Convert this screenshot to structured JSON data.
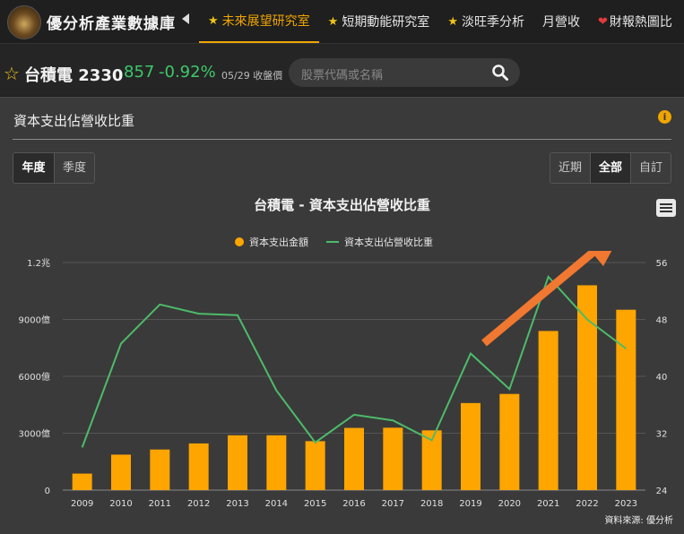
{
  "brand": "優分析產業數據庫",
  "nav": [
    {
      "label": "未來展望研究室",
      "icon": "star",
      "active": true
    },
    {
      "label": "短期動能研究室",
      "icon": "star",
      "active": false
    },
    {
      "label": "淡旺季分析",
      "icon": "star",
      "active": false
    },
    {
      "label": "月營收",
      "icon": "",
      "active": false
    },
    {
      "label": "財報熱圖比",
      "icon": "heart",
      "active": false
    }
  ],
  "stock": {
    "name": "台積電 2330",
    "price": "857",
    "change": "-0.92%",
    "date_label": "05/29 收盤價"
  },
  "search": {
    "placeholder": "股票代碼或名稱"
  },
  "panel": {
    "title": "資本支出佔營收比重",
    "period_tabs": [
      "年度",
      "季度"
    ],
    "period_active": "年度",
    "range_tabs": [
      "近期",
      "全部",
      "自訂"
    ],
    "range_active": "全部"
  },
  "colors": {
    "bar": "#ffa500",
    "line": "#4dbb6a",
    "accent": "#f0a500",
    "trend_arrow": "#f07830"
  },
  "chart_data": {
    "type": "bar",
    "title": "台積電 - 資本支出佔營收比重",
    "legend": [
      "資本支出金額",
      "資本支出佔營收比重"
    ],
    "categories": [
      "2009",
      "2010",
      "2011",
      "2012",
      "2013",
      "2014",
      "2015",
      "2016",
      "2017",
      "2018",
      "2019",
      "2020",
      "2021",
      "2022",
      "2023"
    ],
    "series": [
      {
        "name": "資本支出金額",
        "type": "bar",
        "axis": "left",
        "values": [
          870,
          1870,
          2140,
          2460,
          2890,
          2890,
          2580,
          3280,
          3290,
          3150,
          4590,
          5070,
          8390,
          10800,
          9510
        ]
      },
      {
        "name": "資本支出佔營收比重",
        "type": "line",
        "axis": "right",
        "values": [
          30.0,
          44.6,
          50.1,
          48.8,
          48.6,
          38.0,
          30.7,
          34.6,
          33.8,
          31.0,
          43.2,
          38.2,
          54.0,
          48.0,
          43.9
        ]
      }
    ],
    "y_left": {
      "ticks": [
        "0",
        "3000億",
        "6000億",
        "9000億",
        "1.2兆"
      ],
      "range": [
        0,
        12000
      ],
      "unit": "億"
    },
    "y_right": {
      "ticks": [
        "24",
        "32",
        "40",
        "48",
        "56"
      ],
      "range": [
        24,
        56
      ]
    },
    "grid": true,
    "annotation": "orange trend arrow pointing up-right over 2019-2022",
    "source": "資料來源: 優分析"
  }
}
